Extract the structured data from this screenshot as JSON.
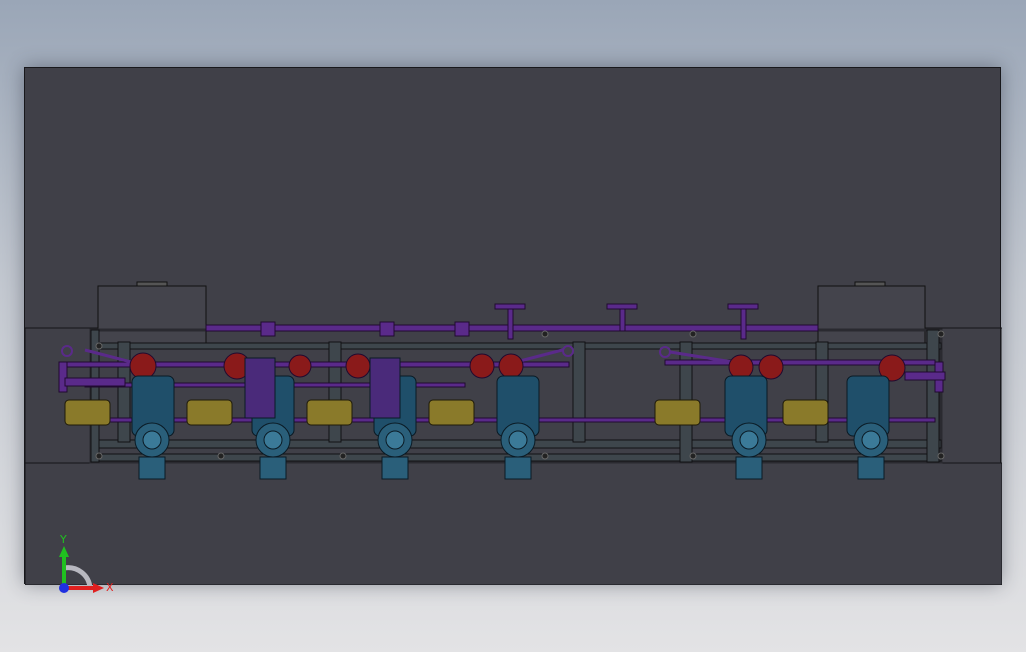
{
  "triad": {
    "x_label": "X",
    "y_label": "Y",
    "x_color": "#e02020",
    "y_color": "#20c020",
    "z_color": "#2030e0"
  },
  "palette": {
    "background_top": "#9aa6b7",
    "background_bottom": "#e3e3e5",
    "viewport": "#404048",
    "frame_edge": "#111114",
    "pipe": "#5a2a8a",
    "pump_body": "#1f4f6a",
    "motor": "#8a7a2a",
    "valve_red": "#8a1a1a"
  },
  "model": {
    "pump_units": 6
  }
}
